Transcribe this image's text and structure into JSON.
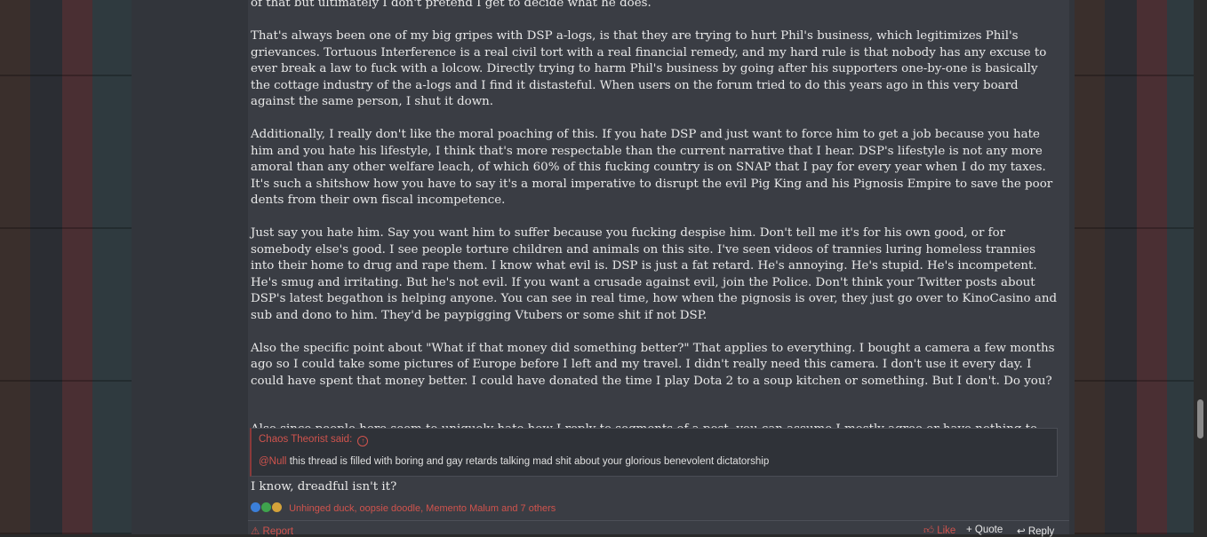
{
  "post": {
    "paragraphs": [
      "of that but ultimately I don't pretend I get to decide what he does.",
      "That's always been one of my big gripes with DSP a-logs, is that they are trying to hurt Phil's business, which legitimizes Phil's grievances. Tortuous Interference is a real civil tort with a real financial remedy, and my hard rule is that nobody has any excuse to ever break a law to fuck with a lolcow. Directly trying to harm Phil's business by going after his supporters one-by-one is basically the cottage industry of the a-logs and I find it distasteful. When users on the forum tried to do this years ago in this very board against the same person, I shut it down.",
      "Additionally, I really don't like the moral poaching of this. If you hate DSP and just want to force him to get a job because you hate him and you hate his lifestyle, I think that's more respectable than the current narrative that I hear. DSP's lifestyle is not any more amoral than any other welfare leach, of which 60% of this fucking country is on SNAP that I pay for every year when I do my taxes. It's such a shitshow how you have to say it's a moral imperative to disrupt the evil Pig King and his Pignosis Empire to save the poor dents from their own fiscal incompetence.",
      "Just say you hate him. Say you want him to suffer because you fucking despise him. Don't tell me it's for his own good, or for somebody else's good. I see people torture children and animals on this site. I've seen videos of trannies luring homeless trannies into their home to drug and rape them. I know what evil is. DSP is just a fat retard. He's annoying. He's stupid. He's incompetent. He's smug and irritating. But he's not evil. If you want a crusade against evil, join the Police. Don't think your Twitter posts about DSP's latest begathon is helping anyone. You can see in real time, how when the pignosis is over, they just go over to KinoCasino and sub and dono to him. They'd be paypigging Vtubers or some shit if not DSP.",
      "Also the specific point about \"What if that money did something better?\" That applies to everything. I bought a camera a few months ago so I could take some pictures of Europe before I left and my travel. I didn't really need this camera. I don't use it every day. I could have spent that money better. I could have donated the time I play Dota 2 to a soup kitchen or something. But I don't. Do you?",
      "Also since people here seem to uniquely hate how I reply to segments of a post, you can assume I mostly agree or have nothing to say about the rest of your post."
    ],
    "quote": {
      "author_line": "Chaos Theorist said:",
      "mention": "@Null",
      "text": " this thread is filled with boring and gay retards talking mad shit about your glorious benevolent dictatorship"
    },
    "reply": "I know, dreadful isn't it?",
    "reactions": {
      "names": "Unhinged duck, oopsie doodle, Memento Malum and 7 others"
    },
    "actions": {
      "report": "Report",
      "like": "Like",
      "quote": "Quote",
      "reply": "Reply"
    }
  }
}
